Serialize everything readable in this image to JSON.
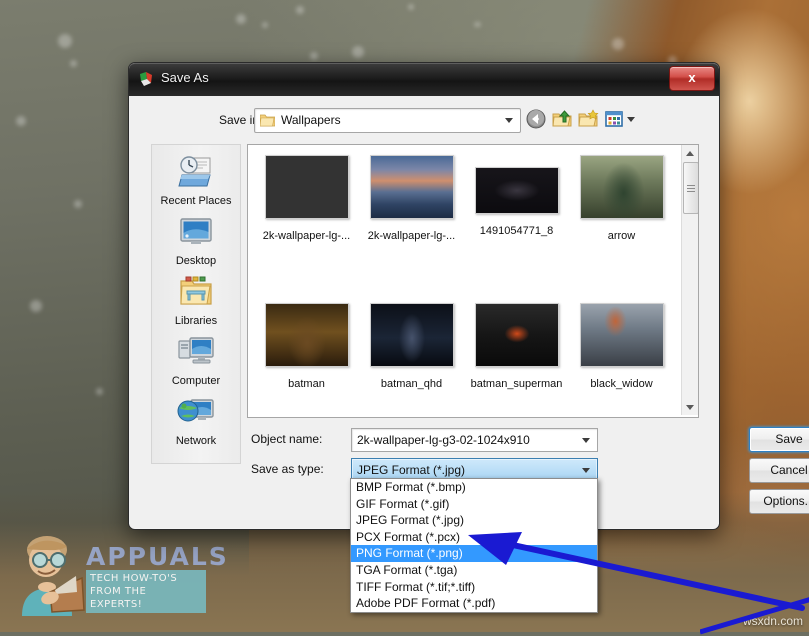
{
  "window": {
    "title": "Save As",
    "title_icon": "paint-app-icon",
    "close_label": "x"
  },
  "toolbar": {
    "save_in_label": "Save in:",
    "current_folder": "Wallpapers",
    "folder_icon": "folder-icon",
    "buttons": [
      {
        "name": "back-button",
        "icon": "back-arrow-icon"
      },
      {
        "name": "up-one-level-button",
        "icon": "up-folder-icon"
      },
      {
        "name": "create-new-folder-button",
        "icon": "new-folder-icon"
      },
      {
        "name": "views-button",
        "icon": "views-grid-icon"
      }
    ]
  },
  "places": {
    "items": [
      {
        "label": "Recent Places",
        "icon": "recent-places-icon"
      },
      {
        "label": "Desktop",
        "icon": "desktop-icon"
      },
      {
        "label": "Libraries",
        "icon": "libraries-icon"
      },
      {
        "label": "Computer",
        "icon": "computer-icon"
      },
      {
        "label": "Network",
        "icon": "network-icon"
      }
    ]
  },
  "files": {
    "items": [
      {
        "label": "2k-wallpaper-lg-...",
        "thumb": "lioness-roaring-thumb"
      },
      {
        "label": "2k-wallpaper-lg-...",
        "thumb": "city-sunset-river-thumb"
      },
      {
        "label": "1491054771_8",
        "thumb": "dark-aircraft-thumb"
      },
      {
        "label": "arrow",
        "thumb": "green-arrow-archer-thumb"
      },
      {
        "label": "batman",
        "thumb": "batman-city-thumb"
      },
      {
        "label": "batman_qhd",
        "thumb": "batman-arkham-thumb"
      },
      {
        "label": "batman_superman",
        "thumb": "batman-superman-logo-thumb"
      },
      {
        "label": "black_widow",
        "thumb": "black-widow-thumb"
      }
    ]
  },
  "form": {
    "object_name_label": "Object name:",
    "object_name_value": "2k-wallpaper-lg-g3-02-1024x910",
    "save_as_type_label": "Save as type:",
    "save_as_type_value": "JPEG Format (*.jpg)"
  },
  "buttons": {
    "save": "Save",
    "cancel": "Cancel",
    "options": "Options..."
  },
  "dropdown": {
    "selected_index": 4,
    "options": [
      "BMP Format (*.bmp)",
      "GIF Format (*.gif)",
      "JPEG Format (*.jpg)",
      "PCX Format (*.pcx)",
      "PNG Format (*.png)",
      "TGA Format (*.tga)",
      "TIFF Format (*.tif;*.tiff)",
      "Adobe PDF Format (*.pdf)"
    ]
  },
  "annotations": {
    "arrow_color": "#1a1ad2",
    "arrow_target": "PNG Format (*.png)"
  },
  "watermarks": {
    "appuals_name": "APPUALS",
    "appuals_tagline": "TECH HOW-TO'S FROM THE EXPERTS!",
    "site": "wsxdn.com"
  },
  "colors": {
    "selection_blue": "#3399ff",
    "combo_highlight": "#a7d4f3",
    "close_red": "#b12d27"
  }
}
